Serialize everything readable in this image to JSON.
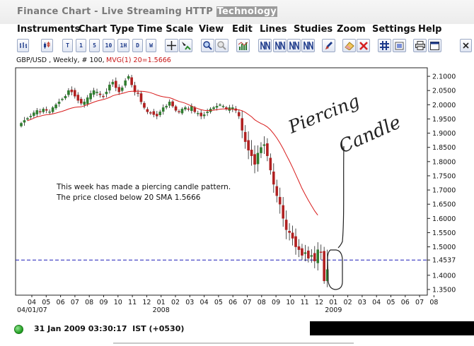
{
  "window": {
    "title_main": "Finance Chart - Live Streaming HTTP ",
    "title_highlight": "Technology"
  },
  "menu": [
    "Instruments",
    "Chart Type",
    "Time Scale",
    "View",
    "Edit",
    "Lines",
    "Studies",
    "Zoom",
    "Settings",
    "Help"
  ],
  "toolbar": {
    "timeframes": [
      "T",
      "1",
      "5",
      "10",
      "1H",
      "D",
      "W"
    ],
    "icons": [
      "bar-chart-icon",
      "candle-chart-icon",
      "crosshair-icon",
      "pointer-icon",
      "zoom-in-icon",
      "zoom-out-icon",
      "volume-icon",
      "trend-lines-icon",
      "draw-icon",
      "eraser-icon",
      "delete-icon",
      "grid-icon",
      "color-icon",
      "print-icon",
      "properties-icon",
      "close-icon"
    ]
  },
  "header": {
    "symbol_info": "GBP/USD , Weekly, # 100,",
    "indicator_info": "MVG(1) 20=1.5666"
  },
  "annotation": {
    "line1": "This week has made a piercing candle pattern.",
    "line2": "The price closed below 20 SMA 1.5666",
    "handwriting_1": "Piercing",
    "handwriting_2": "Candle"
  },
  "price_marker": "1.4537",
  "status": {
    "datetime": "31 Jan 2009 03:30:17  IST (+0530)"
  },
  "colors": {
    "up_candle": "#2f7d2f",
    "down_candle": "#b02020",
    "sma_line": "#d81c1c",
    "marker_line": "#1b1bb8"
  },
  "chart_data": {
    "type": "candlestick",
    "symbol": "GBP/USD",
    "timeframe": "Weekly",
    "bars_count": 100,
    "ylim": [
      1.33,
      2.13
    ],
    "y_ticks": [
      "2.1000",
      "2.0500",
      "2.0000",
      "1.9500",
      "1.9000",
      "1.8500",
      "1.8000",
      "1.7500",
      "1.7000",
      "1.6500",
      "1.6000",
      "1.5500",
      "1.5000",
      "1.4537",
      "1.4000",
      "1.3500"
    ],
    "x_ticks": [
      "04",
      "05",
      "06",
      "07",
      "08",
      "09",
      "10",
      "11",
      "12",
      "01",
      "02",
      "03",
      "04",
      "05",
      "06",
      "07",
      "08",
      "09",
      "10",
      "11",
      "12",
      "01",
      "02",
      "03",
      "04",
      "05",
      "06",
      "07",
      "08"
    ],
    "x_ticks_secondary": [
      "04/01/07",
      "2008",
      "2009"
    ],
    "sma_period": 20,
    "sma_last": 1.5666,
    "marker_price": 1.4537,
    "closes": [
      1.935,
      1.945,
      1.952,
      1.96,
      1.972,
      1.98,
      1.975,
      1.985,
      1.98,
      1.975,
      1.99,
      2.0,
      2.01,
      2.02,
      2.03,
      2.05,
      2.045,
      2.03,
      2.015,
      2.005,
      2.01,
      2.025,
      2.04,
      2.05,
      2.045,
      2.035,
      2.03,
      2.045,
      2.07,
      2.08,
      2.06,
      2.045,
      2.06,
      2.085,
      2.1,
      2.07,
      2.045,
      2.04,
      2.01,
      1.99,
      1.975,
      1.97,
      1.965,
      1.96,
      1.975,
      1.99,
      1.995,
      2.01,
      1.995,
      1.98,
      1.975,
      1.985,
      1.99,
      1.985,
      1.995,
      1.975,
      1.97,
      1.96,
      1.965,
      1.975,
      1.985,
      1.99,
      1.995,
      2.0,
      1.995,
      1.985,
      1.99,
      1.99,
      1.98,
      1.96,
      1.91,
      1.87,
      1.84,
      1.82,
      1.79,
      1.83,
      1.85,
      1.86,
      1.82,
      1.77,
      1.72,
      1.68,
      1.65,
      1.6,
      1.56,
      1.55,
      1.53,
      1.5,
      1.49,
      1.47,
      1.48,
      1.46,
      1.47,
      1.45,
      1.49,
      1.48,
      1.38,
      1.42
    ]
  }
}
